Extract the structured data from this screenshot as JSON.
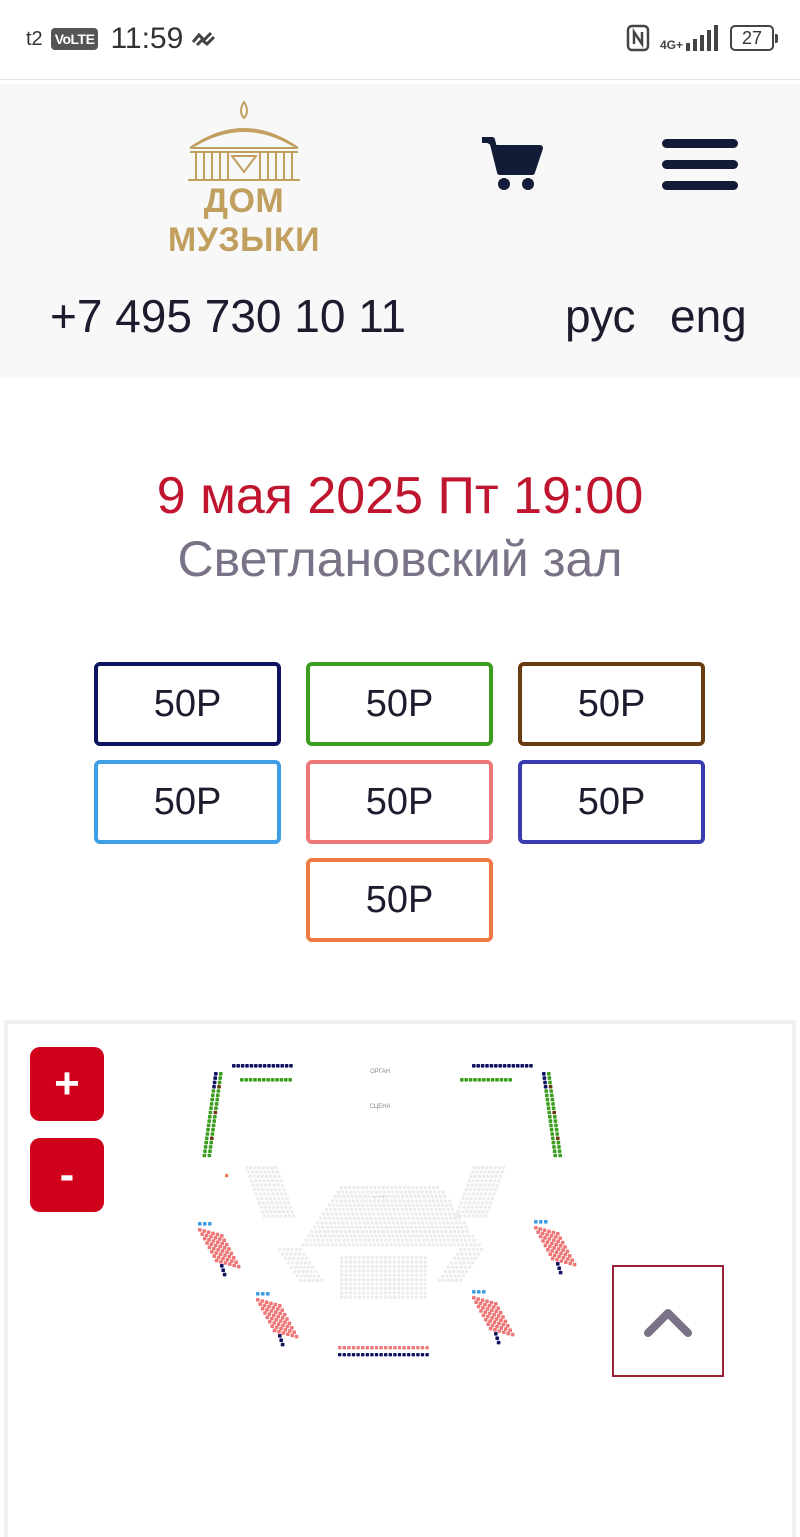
{
  "status": {
    "carrier": "t2",
    "volte": "VoLTE",
    "time": "11:59",
    "network": "4G+",
    "battery": "27"
  },
  "header": {
    "logo_text": "ДОМ МУЗЫКИ",
    "phone": "+7 495 730 10 11",
    "lang_ru": "рус",
    "lang_en": "eng"
  },
  "event": {
    "date": "9 мая 2025 Пт 19:00",
    "hall": "Светлановский зал"
  },
  "prices": [
    {
      "label": "50Р",
      "color": "#0f1460"
    },
    {
      "label": "50Р",
      "color": "#3c9e1f"
    },
    {
      "label": "50Р",
      "color": "#6a3a10"
    },
    {
      "label": "50Р",
      "color": "#3e9ee6"
    },
    {
      "label": "50Р",
      "color": "#ee7777"
    },
    {
      "label": "50Р",
      "color": "#3b3bb0"
    },
    {
      "label": "50Р",
      "color": "#ee7a45"
    }
  ],
  "seatmap": {
    "zoom_in": "+",
    "zoom_out": "-",
    "labels": {
      "organ": "ОРГАН",
      "stage": "СЦЕНА",
      "parterre": "ПАРТЕР"
    }
  },
  "icons": {
    "cart": "cart-icon",
    "menu": "hamburger-menu-icon",
    "scroll_top": "chevron-up-icon",
    "nfc": "nfc-icon",
    "signal": "signal-icon"
  }
}
